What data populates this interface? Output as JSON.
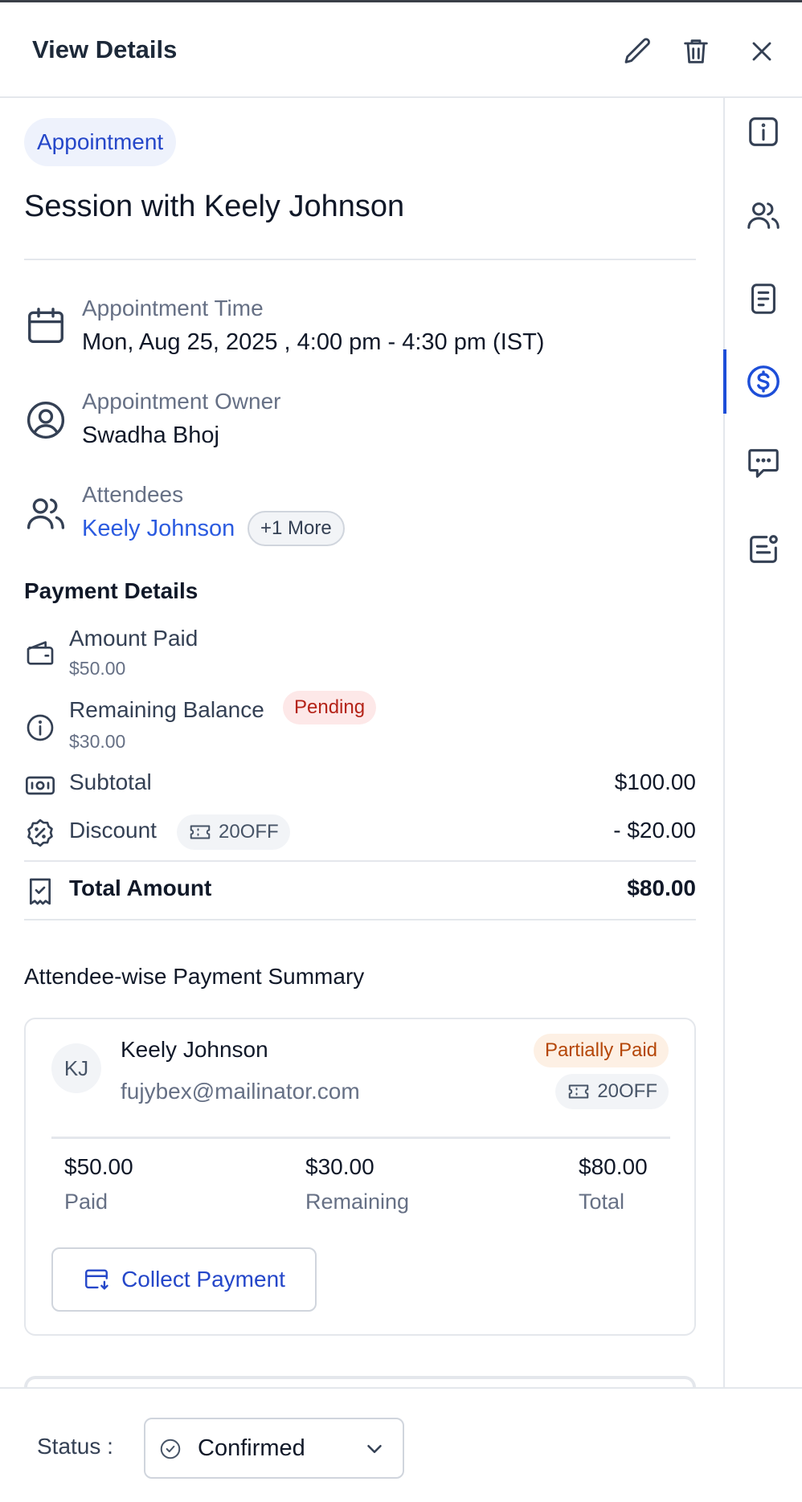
{
  "header": {
    "title": "View Details",
    "edit_icon": "pencil-icon",
    "delete_icon": "trash-icon",
    "close_icon": "close-icon"
  },
  "appointment": {
    "type_tag": "Appointment",
    "title": "Session with Keely Johnson",
    "time_label": "Appointment Time",
    "time_value": "Mon, Aug 25, 2025 , 4:00 pm - 4:30 pm (IST)",
    "owner_label": "Appointment Owner",
    "owner_value": "Swadha Bhoj",
    "attendees_label": "Attendees",
    "attendee_primary": "Keely Johnson",
    "attendees_more": "+1 More"
  },
  "payment": {
    "title": "Payment Details",
    "amount_paid_label": "Amount Paid",
    "amount_paid_value": "$50.00",
    "remaining_label": "Remaining Balance",
    "remaining_badge": "Pending",
    "remaining_value": "$30.00",
    "subtotal_label": "Subtotal",
    "subtotal_value": "$100.00",
    "discount_label": "Discount",
    "discount_code": "20OFF",
    "discount_value": "- $20.00",
    "total_label": "Total Amount",
    "total_value": "$80.00"
  },
  "summary": {
    "title": "Attendee-wise Payment Summary",
    "attendees": [
      {
        "initials": "KJ",
        "name": "Keely Johnson",
        "email": "fujybex@mailinator.com",
        "status": "Partially Paid",
        "coupon": "20OFF",
        "paid_value": "$50.00",
        "paid_label": "Paid",
        "remaining_value": "$30.00",
        "remaining_label": "Remaining",
        "total_value": "$80.00",
        "total_label": "Total",
        "action": "Collect Payment"
      }
    ]
  },
  "rail": {
    "items": [
      "info-icon",
      "users-icon",
      "notes-icon",
      "dollar-icon",
      "chat-icon",
      "form-icon"
    ],
    "active": "dollar-icon"
  },
  "footer": {
    "status_label": "Status :",
    "status_value": "Confirmed"
  },
  "colors": {
    "accent": "#2547c9",
    "link": "#2b5be0",
    "pending_bg": "#fde8e8",
    "pending_text": "#b42318",
    "partial_bg": "#fdf0e4",
    "partial_text": "#b54708"
  }
}
